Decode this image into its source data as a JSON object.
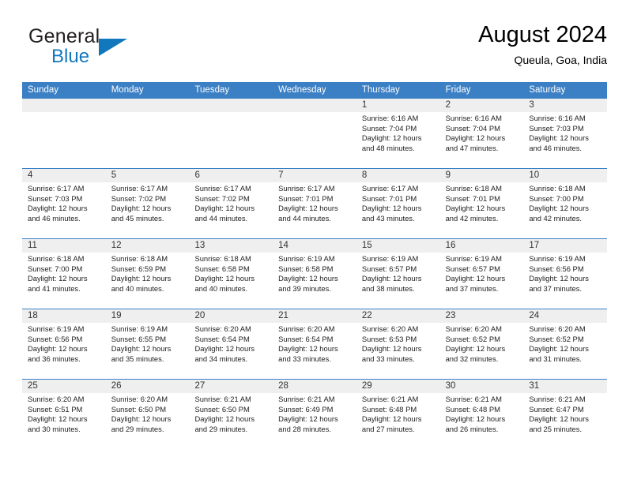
{
  "brand": {
    "name_part1": "General",
    "name_part2": "Blue",
    "triangle_icon": "brand-triangle-icon",
    "accent_color": "#1278be"
  },
  "header": {
    "title": "August 2024",
    "subtitle": "Queula, Goa, India"
  },
  "calendar": {
    "header_bg_color": "#3b7fc4",
    "date_strip_color": "#efefef",
    "weekdays": [
      "Sunday",
      "Monday",
      "Tuesday",
      "Wednesday",
      "Thursday",
      "Friday",
      "Saturday"
    ],
    "weeks": [
      [
        {
          "day": "",
          "lines": [
            "",
            "",
            "",
            ""
          ],
          "empty": true
        },
        {
          "day": "",
          "lines": [
            "",
            "",
            "",
            ""
          ],
          "empty": true
        },
        {
          "day": "",
          "lines": [
            "",
            "",
            "",
            ""
          ],
          "empty": true
        },
        {
          "day": "",
          "lines": [
            "",
            "",
            "",
            ""
          ],
          "empty": true
        },
        {
          "day": "1",
          "lines": [
            "Sunrise: 6:16 AM",
            "Sunset: 7:04 PM",
            "Daylight: 12 hours",
            "and 48 minutes."
          ],
          "empty": false
        },
        {
          "day": "2",
          "lines": [
            "Sunrise: 6:16 AM",
            "Sunset: 7:04 PM",
            "Daylight: 12 hours",
            "and 47 minutes."
          ],
          "empty": false
        },
        {
          "day": "3",
          "lines": [
            "Sunrise: 6:16 AM",
            "Sunset: 7:03 PM",
            "Daylight: 12 hours",
            "and 46 minutes."
          ],
          "empty": false
        }
      ],
      [
        {
          "day": "4",
          "lines": [
            "Sunrise: 6:17 AM",
            "Sunset: 7:03 PM",
            "Daylight: 12 hours",
            "and 46 minutes."
          ],
          "empty": false
        },
        {
          "day": "5",
          "lines": [
            "Sunrise: 6:17 AM",
            "Sunset: 7:02 PM",
            "Daylight: 12 hours",
            "and 45 minutes."
          ],
          "empty": false
        },
        {
          "day": "6",
          "lines": [
            "Sunrise: 6:17 AM",
            "Sunset: 7:02 PM",
            "Daylight: 12 hours",
            "and 44 minutes."
          ],
          "empty": false
        },
        {
          "day": "7",
          "lines": [
            "Sunrise: 6:17 AM",
            "Sunset: 7:01 PM",
            "Daylight: 12 hours",
            "and 44 minutes."
          ],
          "empty": false
        },
        {
          "day": "8",
          "lines": [
            "Sunrise: 6:17 AM",
            "Sunset: 7:01 PM",
            "Daylight: 12 hours",
            "and 43 minutes."
          ],
          "empty": false
        },
        {
          "day": "9",
          "lines": [
            "Sunrise: 6:18 AM",
            "Sunset: 7:01 PM",
            "Daylight: 12 hours",
            "and 42 minutes."
          ],
          "empty": false
        },
        {
          "day": "10",
          "lines": [
            "Sunrise: 6:18 AM",
            "Sunset: 7:00 PM",
            "Daylight: 12 hours",
            "and 42 minutes."
          ],
          "empty": false
        }
      ],
      [
        {
          "day": "11",
          "lines": [
            "Sunrise: 6:18 AM",
            "Sunset: 7:00 PM",
            "Daylight: 12 hours",
            "and 41 minutes."
          ],
          "empty": false
        },
        {
          "day": "12",
          "lines": [
            "Sunrise: 6:18 AM",
            "Sunset: 6:59 PM",
            "Daylight: 12 hours",
            "and 40 minutes."
          ],
          "empty": false
        },
        {
          "day": "13",
          "lines": [
            "Sunrise: 6:18 AM",
            "Sunset: 6:58 PM",
            "Daylight: 12 hours",
            "and 40 minutes."
          ],
          "empty": false
        },
        {
          "day": "14",
          "lines": [
            "Sunrise: 6:19 AM",
            "Sunset: 6:58 PM",
            "Daylight: 12 hours",
            "and 39 minutes."
          ],
          "empty": false
        },
        {
          "day": "15",
          "lines": [
            "Sunrise: 6:19 AM",
            "Sunset: 6:57 PM",
            "Daylight: 12 hours",
            "and 38 minutes."
          ],
          "empty": false
        },
        {
          "day": "16",
          "lines": [
            "Sunrise: 6:19 AM",
            "Sunset: 6:57 PM",
            "Daylight: 12 hours",
            "and 37 minutes."
          ],
          "empty": false
        },
        {
          "day": "17",
          "lines": [
            "Sunrise: 6:19 AM",
            "Sunset: 6:56 PM",
            "Daylight: 12 hours",
            "and 37 minutes."
          ],
          "empty": false
        }
      ],
      [
        {
          "day": "18",
          "lines": [
            "Sunrise: 6:19 AM",
            "Sunset: 6:56 PM",
            "Daylight: 12 hours",
            "and 36 minutes."
          ],
          "empty": false
        },
        {
          "day": "19",
          "lines": [
            "Sunrise: 6:19 AM",
            "Sunset: 6:55 PM",
            "Daylight: 12 hours",
            "and 35 minutes."
          ],
          "empty": false
        },
        {
          "day": "20",
          "lines": [
            "Sunrise: 6:20 AM",
            "Sunset: 6:54 PM",
            "Daylight: 12 hours",
            "and 34 minutes."
          ],
          "empty": false
        },
        {
          "day": "21",
          "lines": [
            "Sunrise: 6:20 AM",
            "Sunset: 6:54 PM",
            "Daylight: 12 hours",
            "and 33 minutes."
          ],
          "empty": false
        },
        {
          "day": "22",
          "lines": [
            "Sunrise: 6:20 AM",
            "Sunset: 6:53 PM",
            "Daylight: 12 hours",
            "and 33 minutes."
          ],
          "empty": false
        },
        {
          "day": "23",
          "lines": [
            "Sunrise: 6:20 AM",
            "Sunset: 6:52 PM",
            "Daylight: 12 hours",
            "and 32 minutes."
          ],
          "empty": false
        },
        {
          "day": "24",
          "lines": [
            "Sunrise: 6:20 AM",
            "Sunset: 6:52 PM",
            "Daylight: 12 hours",
            "and 31 minutes."
          ],
          "empty": false
        }
      ],
      [
        {
          "day": "25",
          "lines": [
            "Sunrise: 6:20 AM",
            "Sunset: 6:51 PM",
            "Daylight: 12 hours",
            "and 30 minutes."
          ],
          "empty": false
        },
        {
          "day": "26",
          "lines": [
            "Sunrise: 6:20 AM",
            "Sunset: 6:50 PM",
            "Daylight: 12 hours",
            "and 29 minutes."
          ],
          "empty": false
        },
        {
          "day": "27",
          "lines": [
            "Sunrise: 6:21 AM",
            "Sunset: 6:50 PM",
            "Daylight: 12 hours",
            "and 29 minutes."
          ],
          "empty": false
        },
        {
          "day": "28",
          "lines": [
            "Sunrise: 6:21 AM",
            "Sunset: 6:49 PM",
            "Daylight: 12 hours",
            "and 28 minutes."
          ],
          "empty": false
        },
        {
          "day": "29",
          "lines": [
            "Sunrise: 6:21 AM",
            "Sunset: 6:48 PM",
            "Daylight: 12 hours",
            "and 27 minutes."
          ],
          "empty": false
        },
        {
          "day": "30",
          "lines": [
            "Sunrise: 6:21 AM",
            "Sunset: 6:48 PM",
            "Daylight: 12 hours",
            "and 26 minutes."
          ],
          "empty": false
        },
        {
          "day": "31",
          "lines": [
            "Sunrise: 6:21 AM",
            "Sunset: 6:47 PM",
            "Daylight: 12 hours",
            "and 25 minutes."
          ],
          "empty": false
        }
      ]
    ]
  }
}
